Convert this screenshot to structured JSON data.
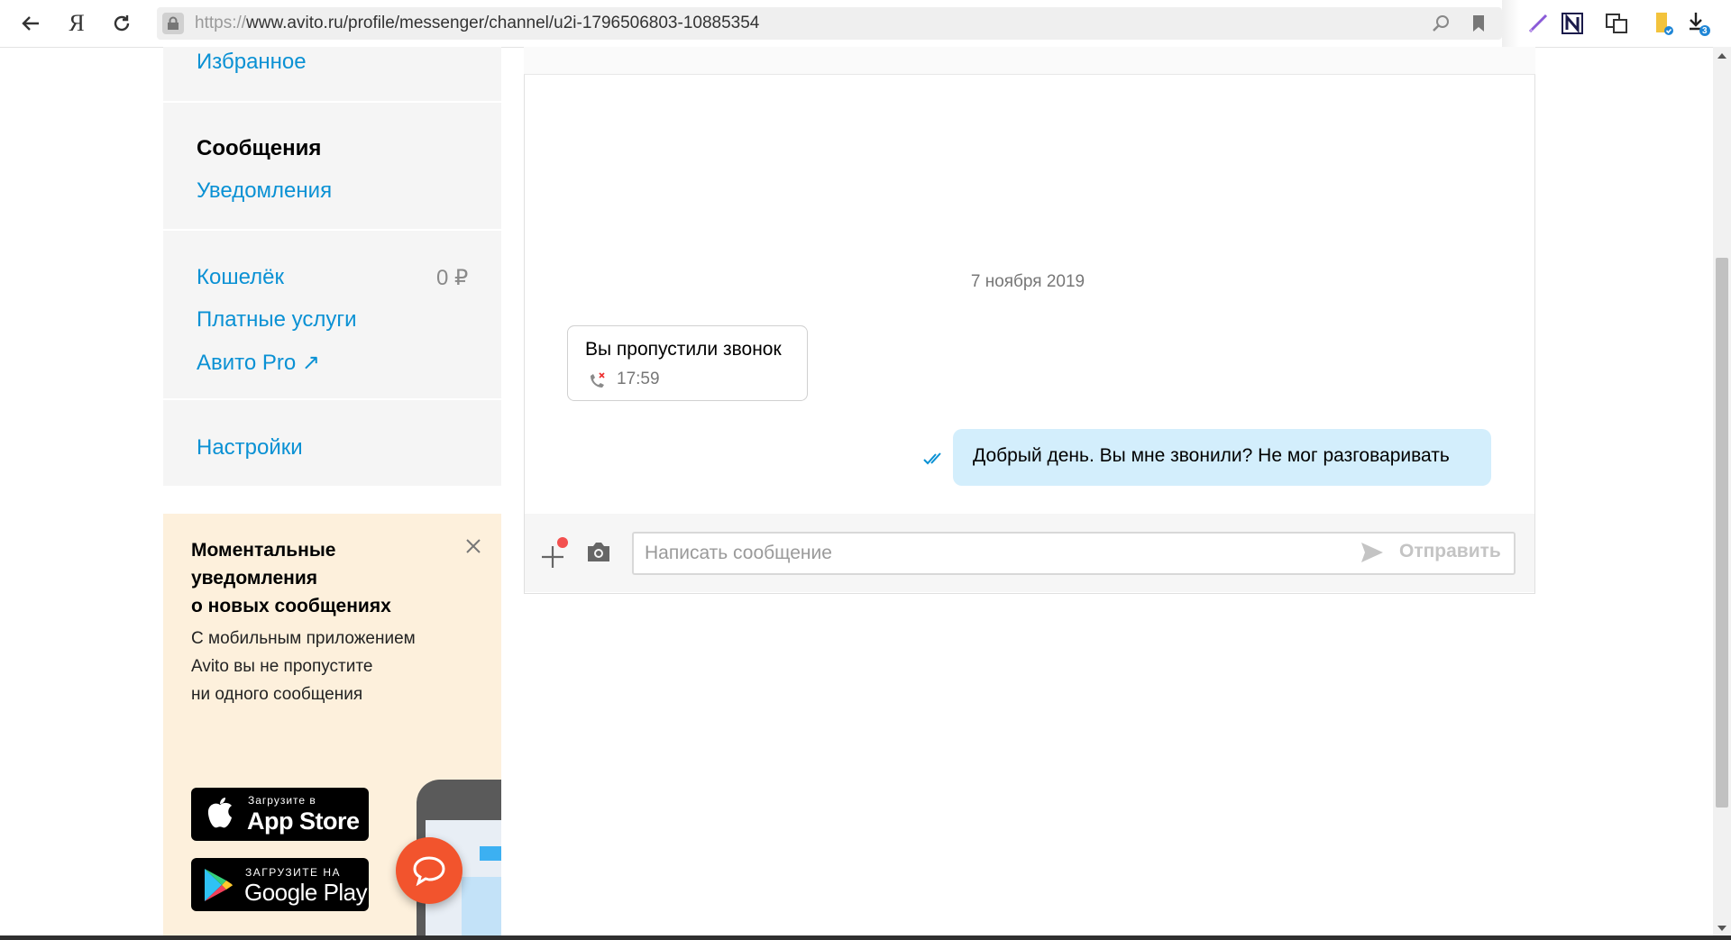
{
  "browser": {
    "url_protocol": "https://",
    "url_rest": "www.avito.ru/profile/messenger/channel/u2i-1796506803-10885354",
    "yandex_label": "Я",
    "download_count": "3"
  },
  "sidebar": {
    "favorites": "Избранное",
    "messages": "Сообщения",
    "notifications": "Уведомления",
    "wallet": "Кошелёк",
    "wallet_balance": "0 ₽",
    "paid_services": "Платные услуги",
    "avito_pro": "Авито Pro",
    "avito_pro_arrow": "↗",
    "settings": "Настройки"
  },
  "promo": {
    "title_line1": "Моментальные",
    "title_line2": "уведомления",
    "title_line3": "о новых сообщениях",
    "text_line1": "С мобильным приложением",
    "text_line2": "Avito вы не пропустите",
    "text_line3": "ни одного сообщения",
    "appstore_small": "Загрузите в",
    "appstore_big": "App Store",
    "googleplay_small": "ЗАГРУЗИТЕ НА",
    "googleplay_big": "Google Play"
  },
  "chat": {
    "date_label": "7 ноября 2019",
    "missed_call_text": "Вы пропустили звонок",
    "missed_call_time": "17:59",
    "outgoing_message": "Добрый день. Вы мне звонили? Не мог разговаривать",
    "input_placeholder": "Написать сообщение",
    "send_label": "Отправить"
  },
  "colors": {
    "link": "#0a91d4",
    "outgoing_bubble": "#d3eefc",
    "promo_bg": "#fdf0dc",
    "fab": "#f2542d"
  }
}
